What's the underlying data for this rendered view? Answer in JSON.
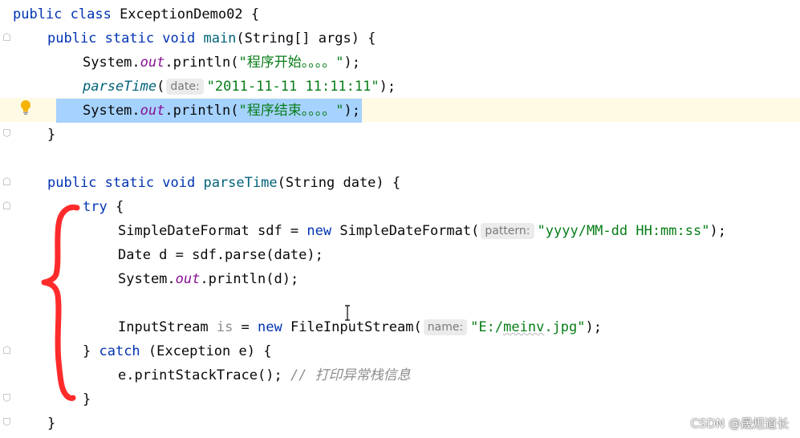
{
  "code": {
    "l1": {
      "t1": "public class ",
      "t2": "ExceptionDemo02 {"
    },
    "l2": {
      "t1": "public static void ",
      "t2": "main",
      "t3": "(String[] args) {"
    },
    "l3": {
      "t1": "System.",
      "t2": "out",
      "t3": ".println(",
      "t4": "\"程序开始。。。。\"",
      "t5": ");"
    },
    "l4": {
      "t1": "parseTime",
      "t2": "(",
      "hint": "date:",
      "t3": "\"2011-11-11 11:11:11\"",
      "t4": ");"
    },
    "l5": {
      "t1": "System.",
      "t2": "out",
      "t3": ".println(",
      "t4": "\"程序结束。。。。\"",
      "t5": ");"
    },
    "l6": {
      "t1": "}"
    },
    "l8": {
      "t1": "public static void ",
      "t2": "parseTime",
      "t3": "(String date) {"
    },
    "l9": {
      "t1": "try",
      "t2": " {"
    },
    "l10": {
      "t1": "SimpleDateFormat sdf = ",
      "t2": "new",
      "t3": " SimpleDateFormat(",
      "hint": "pattern:",
      "t4": "\"yyyy/MM-dd HH:mm:ss\"",
      "t5": ");"
    },
    "l11": {
      "t1": "Date d = sdf.parse(date);"
    },
    "l12": {
      "t1": "System.",
      "t2": "out",
      "t3": ".println(d);"
    },
    "l14": {
      "t1": "InputStream ",
      "t2": "is",
      "t3": " = ",
      "t4": "new",
      "t5": " FileInputStream(",
      "hint": "name:",
      "t6": "\"E:/",
      "t7": "meinv",
      "t8": ".jpg\"",
      "t9": ");"
    },
    "l15": {
      "t1": "} ",
      "t2": "catch",
      "t3": " (Exception e) {"
    },
    "l16": {
      "t1": "e.printStackTrace(); ",
      "t2": "// 打印异常栈信息"
    },
    "l17": {
      "t1": "}"
    },
    "l18": {
      "t1": "}"
    }
  },
  "icons": {
    "bulb": "lightbulb-icon",
    "fold": "fold-marker-icon",
    "cursor": "text-cursor-icon"
  },
  "colors": {
    "keyword": "#0033b3",
    "string": "#067d17",
    "field": "#871094",
    "comment": "#8c8c8c",
    "selection": "#a6d2ff",
    "annotation": "#ff2b2b"
  },
  "watermark": "CSDN @晟炟道长"
}
